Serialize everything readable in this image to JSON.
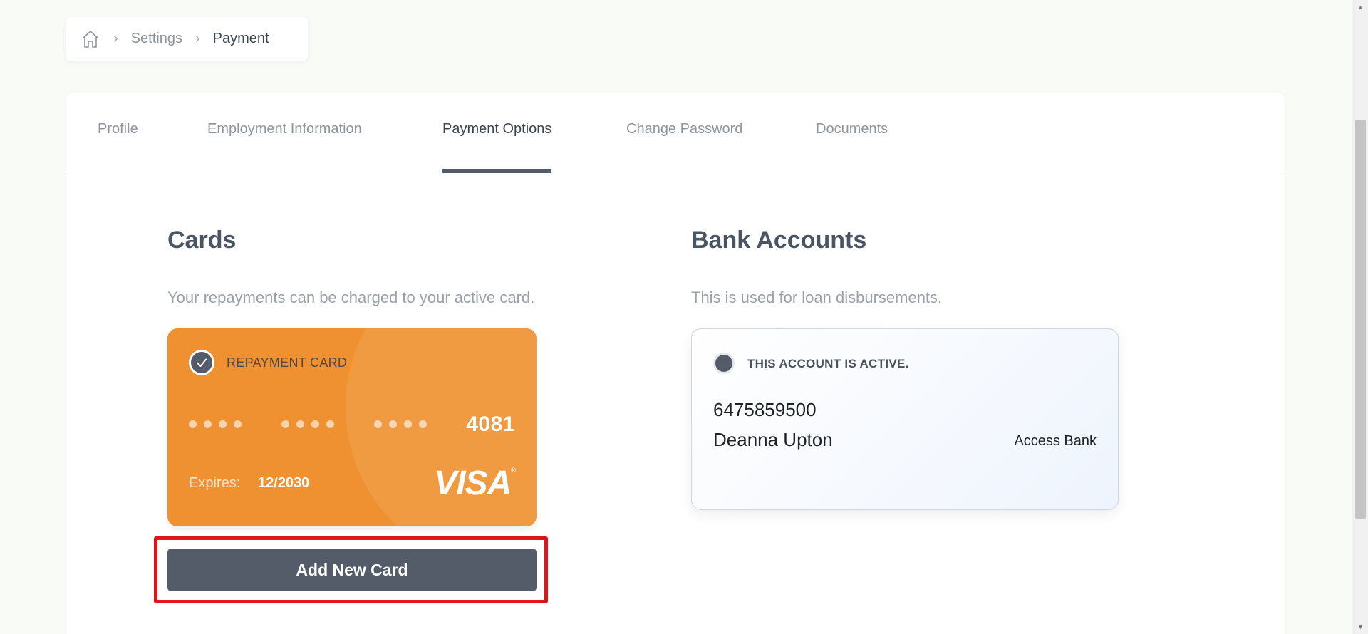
{
  "breadcrumb": {
    "items": [
      "Settings",
      "Payment"
    ]
  },
  "tabs": [
    {
      "label": "Profile",
      "active": false
    },
    {
      "label": "Employment Information",
      "active": false
    },
    {
      "label": "Payment Options",
      "active": true
    },
    {
      "label": "Change Password",
      "active": false
    },
    {
      "label": "Documents",
      "active": false
    }
  ],
  "cards_section": {
    "title": "Cards",
    "description": "Your repayments can be charged to your active card.",
    "card": {
      "label": "REPAYMENT CARD",
      "last4": "4081",
      "expires_label": "Expires:",
      "expires_value": "12/2030",
      "brand": "VISA",
      "color": "#ef9130"
    },
    "add_button_label": "Add New Card"
  },
  "bank_section": {
    "title": "Bank Accounts",
    "description": "This is used for loan disbursements.",
    "account": {
      "status": "THIS ACCOUNT IS ACTIVE.",
      "number": "6475859500",
      "holder": "Deanna Upton",
      "bank": "Access Bank"
    }
  },
  "colors": {
    "accent": "#545c69",
    "highlight": "#e2141b",
    "background": "#f9fbf6"
  }
}
